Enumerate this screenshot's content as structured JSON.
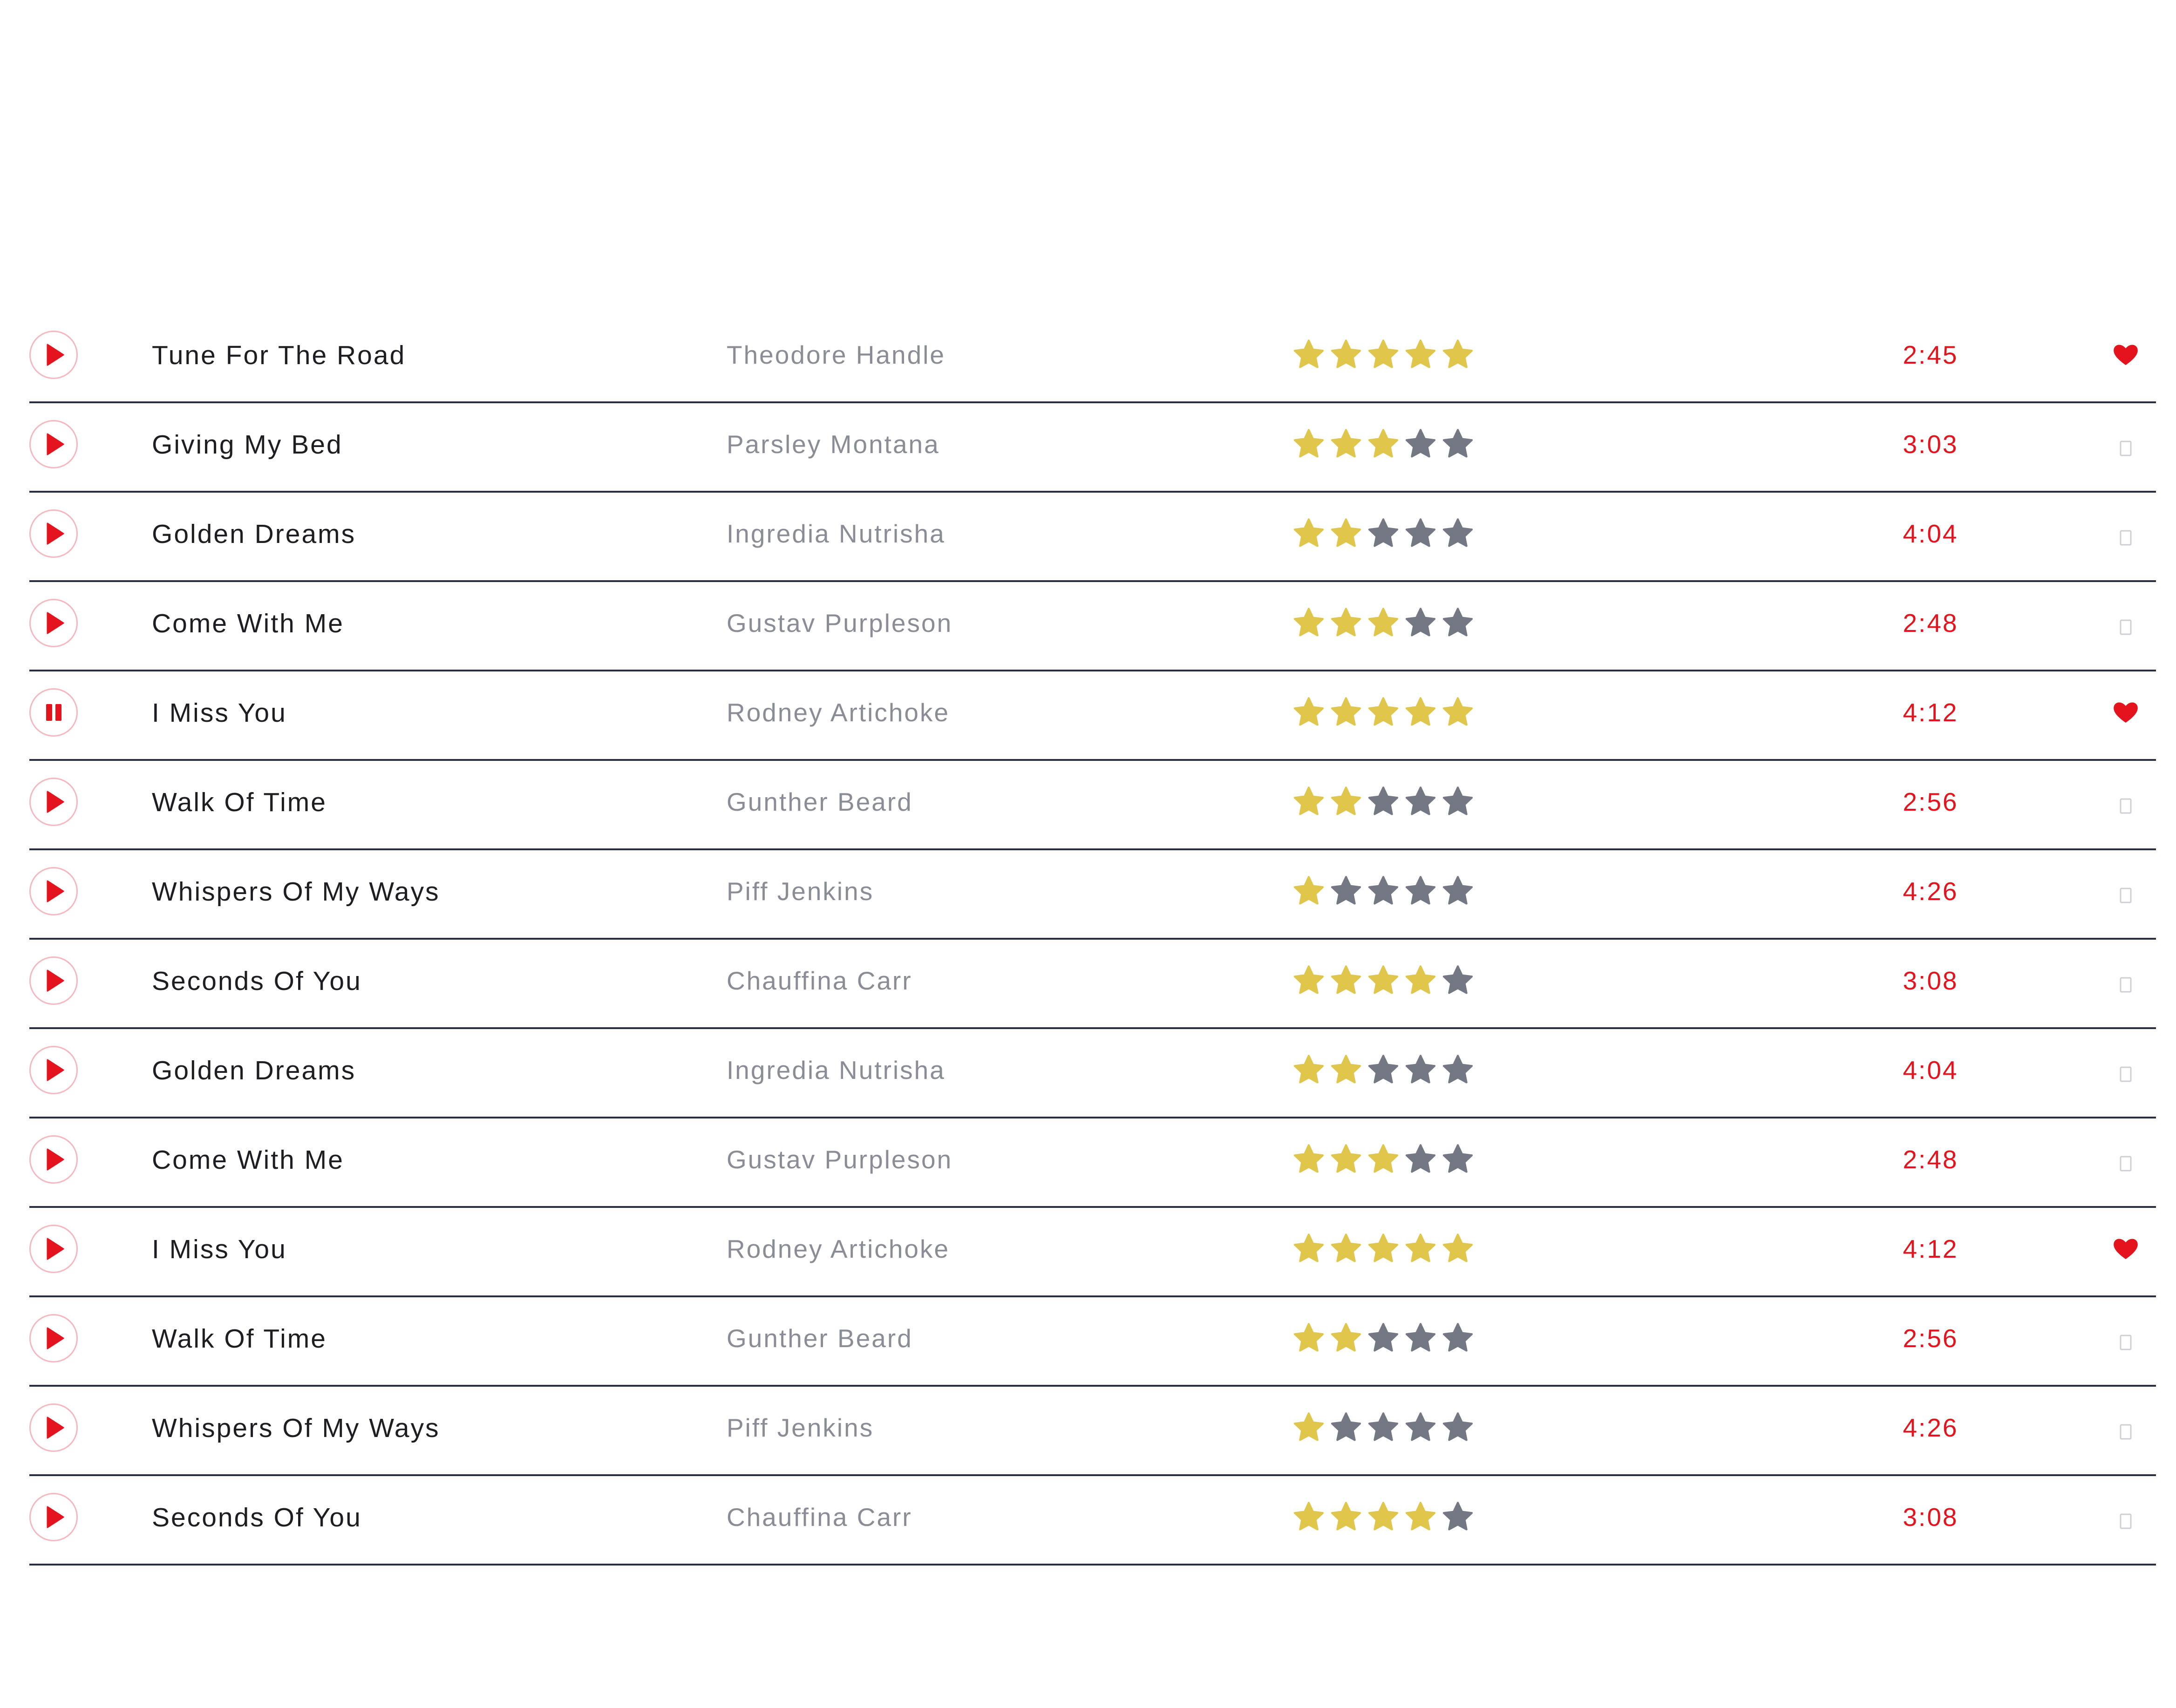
{
  "colors": {
    "accent": "#e3141d",
    "star_filled": "#e0c64a",
    "star_empty": "#737884",
    "divider": "#2b3143",
    "ring": "#f3b9be",
    "empty_fav": "#cfd0d4"
  },
  "playlist": {
    "tracks": [
      {
        "title": "Tune For The Road",
        "artist": "Theodore Handle",
        "rating": 5,
        "duration": "2:45",
        "favorite": true,
        "state": "play"
      },
      {
        "title": "Giving My Bed",
        "artist": "Parsley Montana",
        "rating": 3,
        "duration": "3:03",
        "favorite": false,
        "state": "play"
      },
      {
        "title": "Golden Dreams",
        "artist": "Ingredia Nutrisha",
        "rating": 2,
        "duration": "4:04",
        "favorite": false,
        "state": "play"
      },
      {
        "title": "Come With Me",
        "artist": "Gustav Purpleson",
        "rating": 3,
        "duration": "2:48",
        "favorite": false,
        "state": "play"
      },
      {
        "title": "I Miss You",
        "artist": "Rodney Artichoke",
        "rating": 5,
        "duration": "4:12",
        "favorite": true,
        "state": "pause"
      },
      {
        "title": "Walk Of Time",
        "artist": "Gunther Beard",
        "rating": 2,
        "duration": "2:56",
        "favorite": false,
        "state": "play"
      },
      {
        "title": "Whispers Of My Ways",
        "artist": "Piff Jenkins",
        "rating": 1,
        "duration": "4:26",
        "favorite": false,
        "state": "play"
      },
      {
        "title": "Seconds Of You",
        "artist": "Chauffina Carr",
        "rating": 4,
        "duration": "3:08",
        "favorite": false,
        "state": "play"
      },
      {
        "title": "Golden Dreams",
        "artist": "Ingredia Nutrisha",
        "rating": 2,
        "duration": "4:04",
        "favorite": false,
        "state": "play"
      },
      {
        "title": "Come With Me",
        "artist": "Gustav Purpleson",
        "rating": 3,
        "duration": "2:48",
        "favorite": false,
        "state": "play"
      },
      {
        "title": "I Miss You",
        "artist": "Rodney Artichoke",
        "rating": 5,
        "duration": "4:12",
        "favorite": true,
        "state": "play"
      },
      {
        "title": "Walk Of Time",
        "artist": "Gunther Beard",
        "rating": 2,
        "duration": "2:56",
        "favorite": false,
        "state": "play"
      },
      {
        "title": "Whispers Of My Ways",
        "artist": "Piff Jenkins",
        "rating": 1,
        "duration": "4:26",
        "favorite": false,
        "state": "play"
      },
      {
        "title": "Seconds Of You",
        "artist": "Chauffina Carr",
        "rating": 4,
        "duration": "3:08",
        "favorite": false,
        "state": "play"
      }
    ]
  }
}
